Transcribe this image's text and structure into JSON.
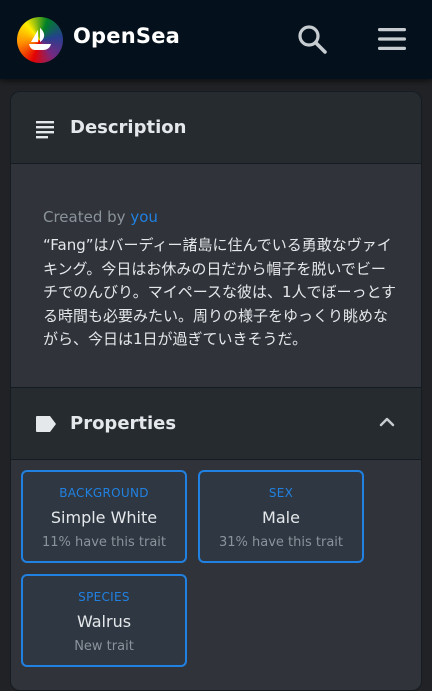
{
  "header": {
    "brand": "OpenSea",
    "logo_icon": "opensea-logo-rainbow",
    "search_icon": "search-icon",
    "menu_icon": "menu-icon"
  },
  "description": {
    "title": "Description",
    "created_by_prefix": "Created by",
    "creator": "you",
    "text": "“Fang”はバーディー諸島に住んでいる勇敢なヴァイキング。今日はお休みの日だから帽子を脱いでビーチでのんびり。マイペースな彼は、1人でぼーっとする時間も必要みたい。周りの様子をゆっくり眺めながら、今日は1日が過ぎていきそうだ。"
  },
  "properties": {
    "title": "Properties",
    "traits": [
      {
        "type": "BACKGROUND",
        "value": "Simple White",
        "rarity": "11% have this trait"
      },
      {
        "type": "SEX",
        "value": "Male",
        "rarity": "31% have this trait"
      },
      {
        "type": "SPECIES",
        "value": "Walrus",
        "rarity": "New trait"
      }
    ]
  },
  "colors": {
    "accent": "#2081e2",
    "header_bg": "#04111d",
    "panel_bg": "#303339",
    "muted_text": "#8a939b"
  }
}
